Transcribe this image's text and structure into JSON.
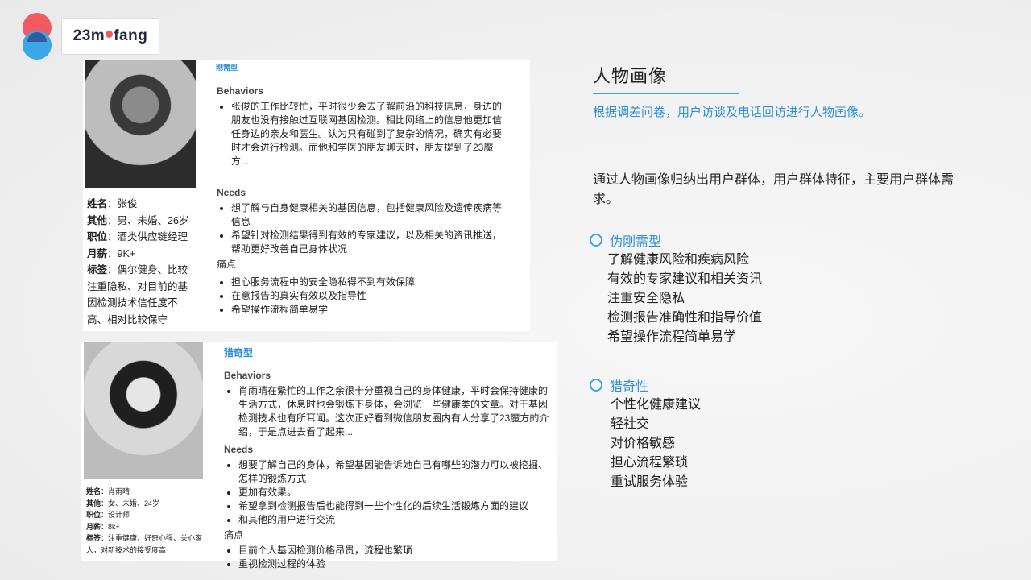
{
  "brand": {
    "prefix": "23m",
    "suffix": "fang",
    "logo_colors": [
      "#f25a5f",
      "#3aa7e8",
      "#2d4f8f"
    ]
  },
  "persona1": {
    "type_label": "刚需型",
    "info": [
      {
        "key": "姓名",
        "value": "：张俊"
      },
      {
        "key": "其他",
        "value": "：男、未婚、26岁"
      },
      {
        "key": "职位",
        "value": "：酒类供应链经理"
      },
      {
        "key": "月薪",
        "value": "：9K+"
      },
      {
        "key": "标签",
        "value": "：偶尔健身、比较注重隐私、对目前的基因检测技术信任度不高、相对比较保守"
      }
    ],
    "behaviors_title": "Behaviors",
    "behaviors": [
      "张俊的工作比较忙，平时很少会去了解前沿的科技信息，身边的朋友也没有接触过互联网基因检测。相比网络上的信息他更加信任身边的亲友和医生。认为只有碰到了复杂的情况，确实有必要时才会进行检测。而他和学医的朋友聊天时，朋友提到了23魔方..."
    ],
    "needs_title": "Needs",
    "needs": [
      "想了解与自身健康相关的基因信息，包括健康风险及遗传疾病等信息",
      "希望针对检测结果得到有效的专家建议，以及相关的资讯推送，帮助更好改善自己身体状况"
    ],
    "pain_title": "痛点",
    "pain": [
      "担心服务流程中的安全隐私得不到有效保障",
      "在意报告的真实有效以及指导性",
      "希望操作流程简单易学"
    ]
  },
  "persona2": {
    "type_label": "猎奇型",
    "info": [
      {
        "key": "姓名",
        "value": "：肖雨晴"
      },
      {
        "key": "其他",
        "value": "：女、未婚、24岁"
      },
      {
        "key": "职位",
        "value": "：设计师"
      },
      {
        "key": "月薪",
        "value": "：8k+"
      },
      {
        "key": "标签",
        "value": "：注重健康、好奇心强、关心家人，对新技术的接受度高"
      }
    ],
    "behaviors_title": "Behaviors",
    "behaviors": [
      "肖雨晴在繁忙的工作之余很十分重视自己的身体健康，平时会保持健康的生活方式，休息时也会锻炼下身体，会浏览一些健康类的文章。对于基因检测技术也有所耳闻。这次正好看到微信朋友圈内有人分享了23魔方的介绍，于是点进去看了起来..."
    ],
    "needs_title": "Needs",
    "needs": [
      "想要了解自己的身体，希望基因能告诉她自己有哪些的潜力可以被挖掘、怎样的锻炼方式",
      "更加有效果。",
      "希望拿到检测报告后也能得到一些个性化的后续生活锻炼方面的建议",
      "和其他的用户进行交流"
    ],
    "pain_title": "痛点",
    "pain": [
      "目前个人基因检测价格昂贵，流程也繁琐",
      "重视检测过程的体验"
    ]
  },
  "right": {
    "title": "人物画像",
    "subtitle": "根据调差问卷，用户访谈及电话回访进行人物画像。",
    "description": "通过人物画像归纳出用户群体，用户群体特征，主要用户群体需求。",
    "group1": {
      "title": "伪刚需型",
      "items": [
        "了解健康风险和疾病风险",
        "有效的专家建议和相关资讯",
        "注重安全隐私",
        "检测报告准确性和指导价值",
        "希望操作流程简单易学"
      ]
    },
    "group2": {
      "title": "猎奇性",
      "items": [
        "个性化健康建议",
        "轻社交",
        "对价格敏感",
        "担心流程繁琐",
        "重试服务体验"
      ]
    },
    "accent_color": "#2e8fd6"
  }
}
